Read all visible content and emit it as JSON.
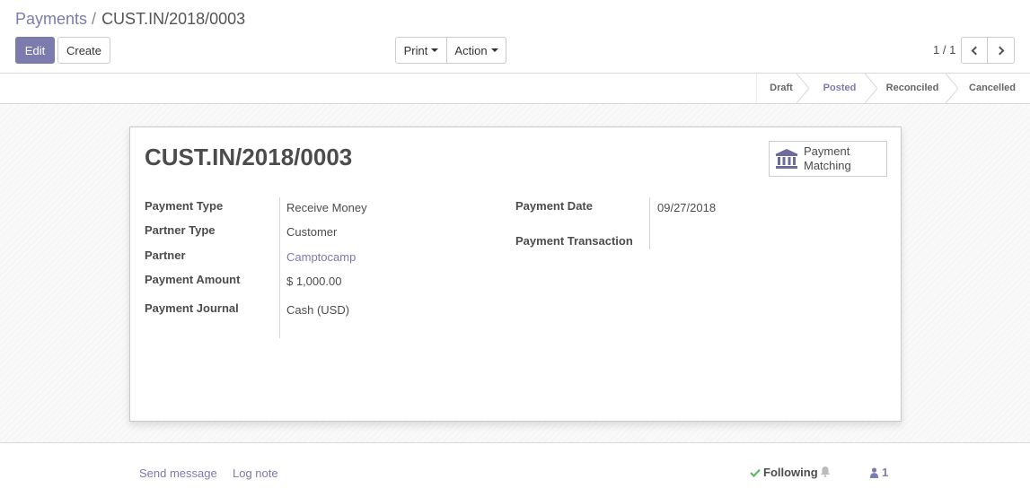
{
  "breadcrumb": {
    "parent": "Payments",
    "separator": "/",
    "current": "CUST.IN/2018/0003"
  },
  "buttons": {
    "edit": "Edit",
    "create": "Create",
    "print": "Print",
    "action": "Action"
  },
  "pager": {
    "value": "1 / 1",
    "prev_icon": "chevron-left-icon",
    "next_icon": "chevron-right-icon"
  },
  "statusbar": {
    "stages": [
      "Draft",
      "Posted",
      "Reconciled",
      "Cancelled"
    ],
    "active": "Posted"
  },
  "record": {
    "title": "CUST.IN/2018/0003",
    "smart_button": {
      "icon": "bank-icon",
      "line1": "Payment",
      "line2": "Matching"
    },
    "left_fields": [
      {
        "label": "Payment Type",
        "value": "Receive Money"
      },
      {
        "label": "Partner Type",
        "value": "Customer"
      },
      {
        "label": "Partner",
        "value": "Camptocamp"
      },
      {
        "label": "Payment Amount",
        "value": "$ 1,000.00"
      },
      {
        "label": "Payment Journal",
        "value": "Cash (USD)"
      }
    ],
    "right_fields": [
      {
        "label": "Payment Date",
        "value": "09/27/2018"
      },
      {
        "label": "Payment Transaction",
        "value": ""
      }
    ]
  },
  "chatter": {
    "send_message": "Send message",
    "log_note": "Log note",
    "following": "Following",
    "followers_count": "1",
    "follow_icon": "check-icon",
    "bell_icon": "bell-icon",
    "user_icon": "user-icon"
  },
  "colors": {
    "brand": "#7c7bad",
    "following_check": "#5cb85c"
  }
}
